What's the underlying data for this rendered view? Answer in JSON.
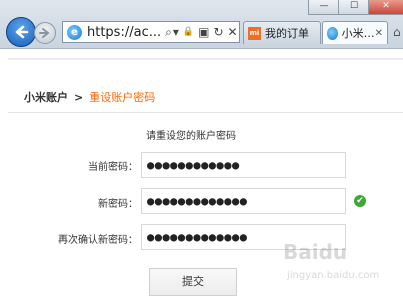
{
  "browser": {
    "window_controls": [
      "—",
      "☐",
      "✕"
    ],
    "address": "https://ac...",
    "address_icons": {
      "search": "⌕",
      "dropdown": "▾",
      "lock": "🔒",
      "mixed": "▣",
      "refresh": "↻",
      "stop": "✕"
    },
    "tabs": [
      {
        "label": "我的订单",
        "favicon": "mi-logo-icon",
        "active": false
      },
      {
        "label": "小米…",
        "favicon": "ie-logo-icon",
        "active": true,
        "close": "✕"
      }
    ]
  },
  "page": {
    "breadcrumb": {
      "root": "小米账户",
      "separator": ">",
      "current": "重设账户密码"
    },
    "instruction": "请重设您的账户密码",
    "fields": [
      {
        "label": "当前密码：",
        "value": "●●●●●●●●●●●●"
      },
      {
        "label": "新密码：",
        "value": "●●●●●●●●●●●●●"
      },
      {
        "label": "再次确认新密码：",
        "value": "●●●●●●●●●●●●●"
      }
    ],
    "new_password_valid_mark": "✔",
    "submit_label": "提交",
    "watermark": {
      "logo": "Baidu",
      "sub": "jingyan.baidu.com"
    },
    "accent_color": "#ff6700",
    "valid_color": "#3aa935"
  }
}
